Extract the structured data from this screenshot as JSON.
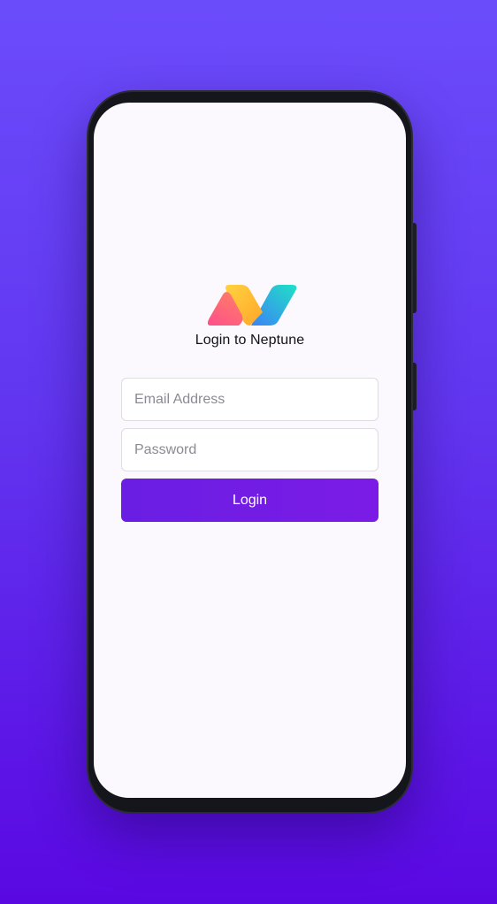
{
  "app": {
    "name": "Neptune",
    "logo_icon": "neptune-logo-icon"
  },
  "login": {
    "title": "Login to Neptune",
    "email_placeholder": "Email Address",
    "email_value": "",
    "password_placeholder": "Password",
    "password_value": "",
    "submit_label": "Login"
  },
  "colors": {
    "background_top": "#6b4cfb",
    "background_bottom": "#5a08e2",
    "button": "#6a1ee3",
    "screen": "#fbf9fd"
  }
}
